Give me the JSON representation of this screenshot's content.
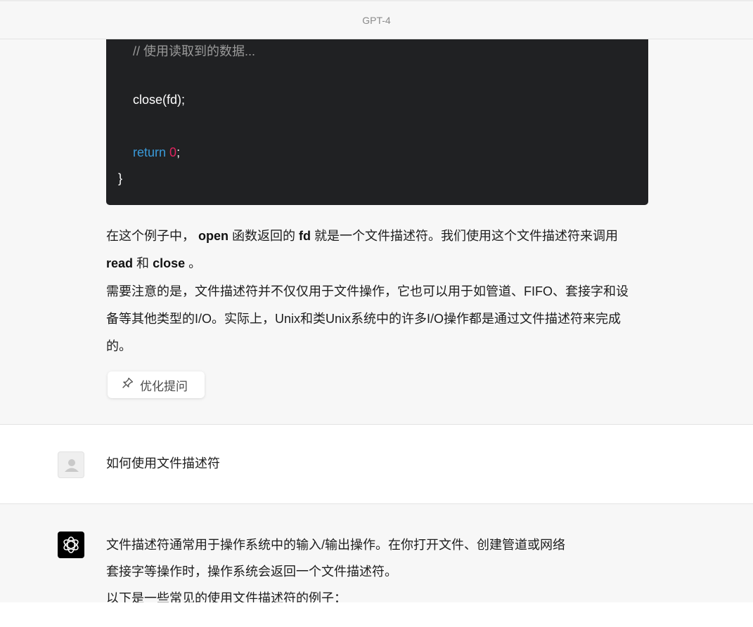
{
  "header": {
    "model_label": "GPT-4"
  },
  "code": {
    "comment": "// 使用读取到的数据...",
    "close_call": "close(fd);",
    "return_kw": "return",
    "return_val": "0",
    "semicolon": ";",
    "closing_brace": "}"
  },
  "answer": {
    "p1_a": "在这个例子中，",
    "p1_open": "open",
    "p1_b": "函数返回的",
    "p1_fd": "fd",
    "p1_c": "就是一个文件描述符。我们使用这个文件描述符来调用",
    "p1_read": "read",
    "p1_d": "和",
    "p1_close": "close",
    "p1_e": "。",
    "p2": "需要注意的是，文件描述符并不仅仅用于文件操作，它也可以用于如管道、FIFO、套接字和设备等其他类型的I/O。实际上，Unix和类Unix系统中的许多I/O操作都是通过文件描述符来完成的。"
  },
  "optimize_button": {
    "label": "优化提问",
    "icon": "pin-icon"
  },
  "user_message": {
    "text": "如何使用文件描述符",
    "avatar": "user-avatar"
  },
  "assistant_reply": {
    "line1": "文件描述符通常用于操作系统中的输入/输出操作。在你打开文件、创建管道或网络",
    "line2": "套接字等操作时，操作系统会返回一个文件描述符。",
    "line3": "以下是一些常见的使用文件描述符的例子："
  }
}
